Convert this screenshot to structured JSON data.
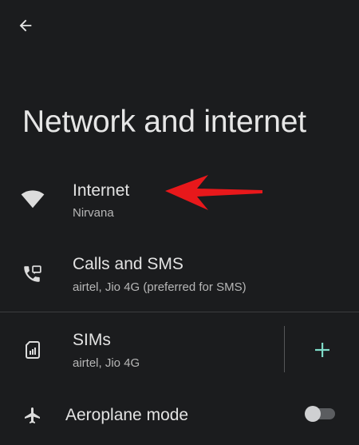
{
  "header": {
    "back_icon": "arrow-left-icon",
    "title": "Network and internet"
  },
  "items": [
    {
      "icon": "wifi-icon",
      "title": "Internet",
      "subtitle": "Nirvana"
    },
    {
      "icon": "calls-sms-icon",
      "title": "Calls and SMS",
      "subtitle": "airtel, Jio 4G (preferred for SMS)"
    },
    {
      "icon": "sim-card-icon",
      "title": "SIMs",
      "subtitle": "airtel, Jio 4G",
      "action_icon": "plus-icon"
    },
    {
      "icon": "airplane-icon",
      "title": "Aeroplane mode",
      "toggle_state": "off"
    }
  ],
  "colors": {
    "background": "#1b1c1e",
    "text_primary": "#e3e3e3",
    "text_secondary": "#b7b7b7",
    "accent": "#7fdcc9",
    "annotation_arrow": "#e8181b"
  }
}
